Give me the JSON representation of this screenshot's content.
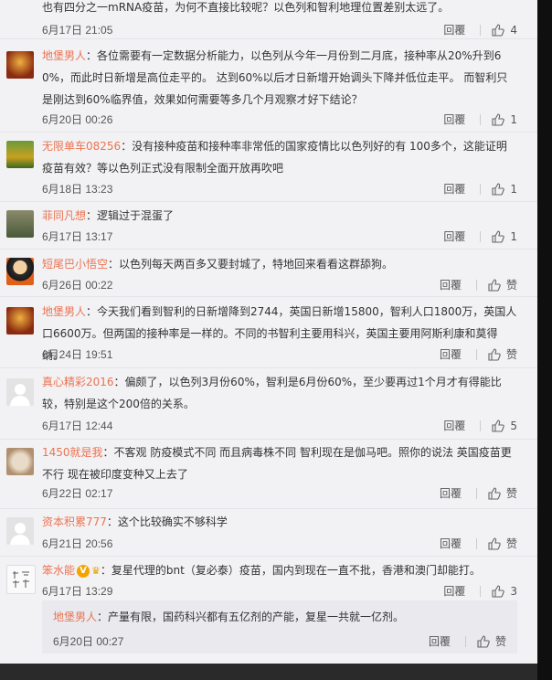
{
  "comments": [
    {
      "user": "",
      "text": "也有四分之一mRNA疫苗，为何不直接比较呢？以色列和智利地理位置差别太远了。",
      "time": "6月17日 21:05",
      "reply": "回覆",
      "likes": "4"
    },
    {
      "user": "地堡男人",
      "text": "：各位需要有一定数据分析能力，以色列从今年一月份到二月底，接种率从20%升到60%，而此时日新增是高位走平的。 达到60%以后才日新增开始调头下降并低位走平。 而智利只是刚达到60%临界值，效果如何需要等多几个月观察才好下结论？",
      "time": "6月20日 00:26",
      "reply": "回覆",
      "likes": "1"
    },
    {
      "user": "无限单车08256",
      "text": "：没有接种疫苗和接种率非常低的国家疫情比以色列好的有 100多个，这能证明疫苗有效？等以色列正式没有限制全面开放再吹吧",
      "time": "6月18日 13:23",
      "reply": "回覆",
      "likes": "1"
    },
    {
      "user": "菲同凡想",
      "text": "：逻辑过于混蛋了",
      "time": "6月17日 13:17",
      "reply": "回覆",
      "likes": "1"
    },
    {
      "user": "短尾巴小悟空",
      "text": "：以色列每天两百多又要封城了，特地回来看看这群舔狗。",
      "time": "6月26日 00:22",
      "reply": "回覆",
      "likes": "赞"
    },
    {
      "user": "地堡男人",
      "text": "：今天我们看到智利的日新增降到2744，英国日新增15800，智利人口1800万，英国人口6600万。但两国的接种率是一样的。不同的书智利主要用科兴，英国主要用阿斯利康和莫得纳。",
      "time": "6月24日 19:51",
      "reply": "回覆",
      "likes": "赞"
    },
    {
      "user": "真心精彩2016",
      "text": "：偏颇了，以色列3月份60%，智利是6月份60%，至少要再过1个月才有得能比较，特别是这个200倍的关系。",
      "time": "6月17日 12:44",
      "reply": "回覆",
      "likes": "5"
    },
    {
      "user": "1450就是我",
      "text": "：不客观 防疫模式不同 而且病毒株不同 智利现在是伽马吧。照你的说法 英国疫苗更不行 现在被印度变种又上去了",
      "time": "6月22日 02:17",
      "reply": "回覆",
      "likes": "赞"
    },
    {
      "user": "资本积累777",
      "text": "：这个比较确实不够科学",
      "time": "6月21日 20:56",
      "reply": "回覆",
      "likes": "赞"
    },
    {
      "user": "笨水能",
      "text": "：复星代理的bnt（复必泰）疫苗，国内到现在一直不批，香港和澳门却能打。",
      "time": "6月17日 13:29",
      "reply": "回覆",
      "likes": "3"
    }
  ],
  "sub_reply": {
    "user": "地堡男人",
    "text": "：产量有限，国药科兴都有五亿剂的产能，复星一共就一亿剂。",
    "time": "6月20日 00:27",
    "reply": "回覆",
    "likes": "赞"
  },
  "colors": {
    "username": "#eb7350",
    "panel": "#f2f2f5",
    "vip": "#f5a300"
  }
}
